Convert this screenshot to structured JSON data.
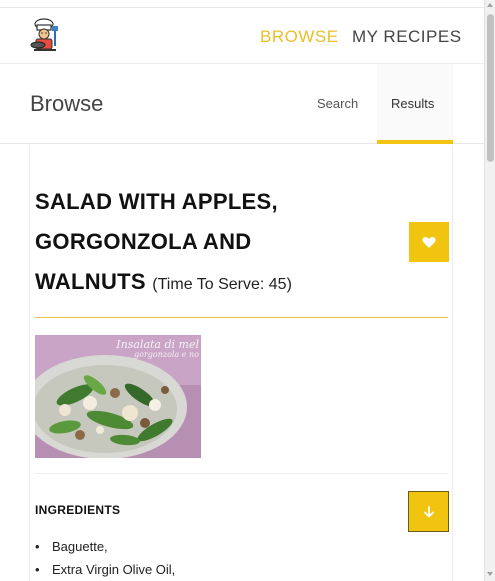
{
  "nav": {
    "browse_label": "BROWSE",
    "my_recipes_label": "MY RECIPES",
    "active_color": "#e9bf2a",
    "logo_icon": "chef-icon"
  },
  "subheader": {
    "title": "Browse",
    "tabs": [
      {
        "label": "Search",
        "active": false
      },
      {
        "label": "Results",
        "active": true
      }
    ],
    "accent_color": "#f1c40f"
  },
  "recipe": {
    "title_lines": [
      "SALAD WITH APPLES,",
      "GORGONZOLA AND",
      "WALNUTS"
    ],
    "serve_time": "(Time To Serve: 45)",
    "favorite_icon": "heart-icon",
    "image_caption": "Insalata di mel",
    "image_subcaption": "gorgonzola e no",
    "ingredients_heading": "INGREDIENTS",
    "expand_icon": "arrow-down-icon",
    "ingredients": [
      "Baguette,",
      "Extra Virgin Olive Oil,"
    ]
  }
}
